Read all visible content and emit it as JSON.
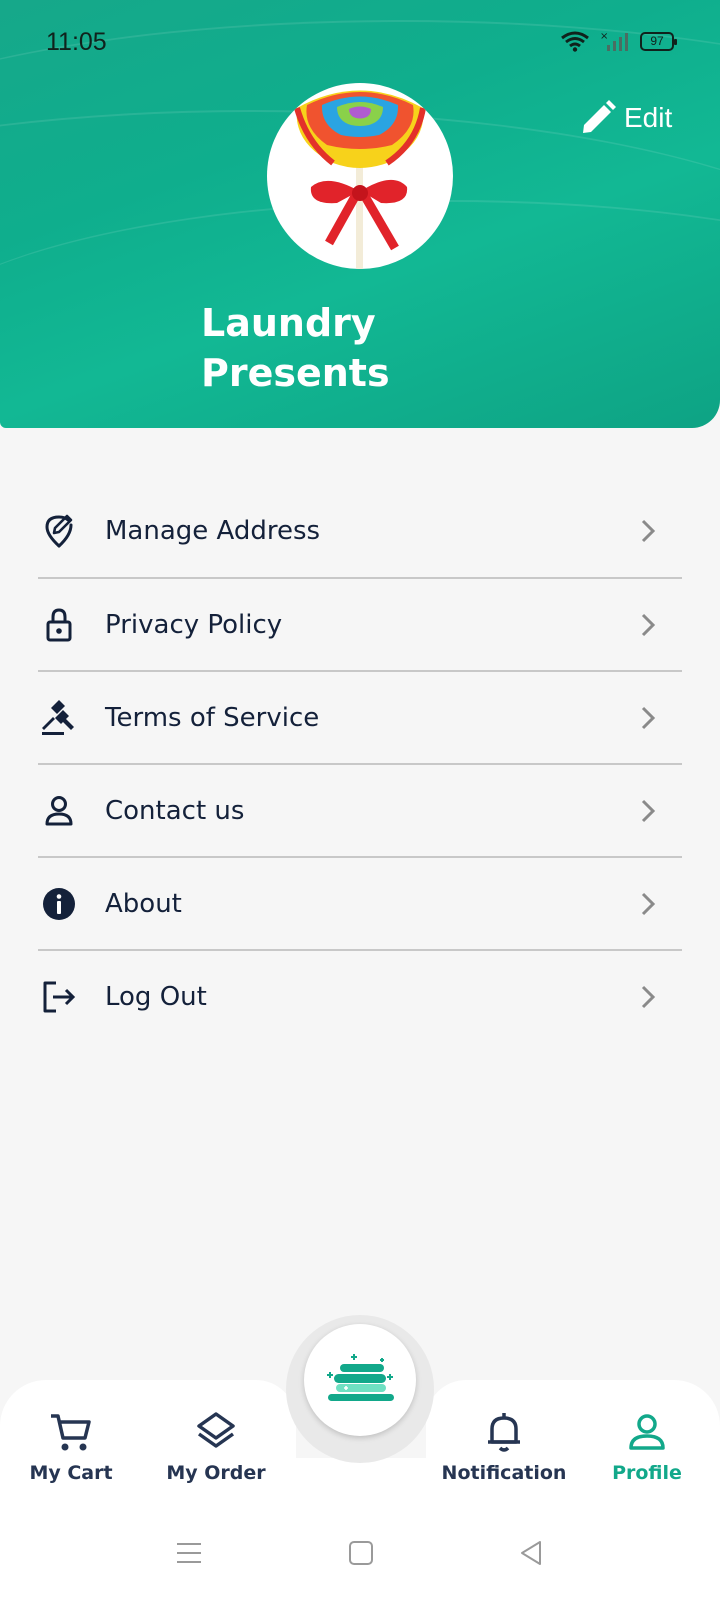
{
  "status_bar": {
    "time": "11:05",
    "battery": "97"
  },
  "header": {
    "edit_label": "Edit",
    "user_name": "Laundry Presents",
    "accent_color": "#12ae8e"
  },
  "menu": {
    "items": [
      {
        "label": "Manage Address",
        "icon": "location-edit-icon"
      },
      {
        "label": "Privacy Policy",
        "icon": "lock-icon"
      },
      {
        "label": "Terms of Service",
        "icon": "gavel-icon"
      },
      {
        "label": "Contact us",
        "icon": "person-icon"
      },
      {
        "label": "About",
        "icon": "info-icon"
      },
      {
        "label": "Log Out",
        "icon": "logout-icon"
      }
    ]
  },
  "bottom_nav": {
    "items": [
      {
        "label": "My Cart",
        "icon": "cart-icon"
      },
      {
        "label": "My Order",
        "icon": "layers-icon"
      },
      {
        "label": "Notification",
        "icon": "bell-icon"
      },
      {
        "label": "Profile",
        "icon": "profile-icon",
        "active": true
      }
    ],
    "center_icon": "laundry-stack-icon",
    "active_color": "#12a88a"
  },
  "system_nav": {
    "icons": [
      "menu-icon",
      "home-icon",
      "back-icon"
    ]
  }
}
